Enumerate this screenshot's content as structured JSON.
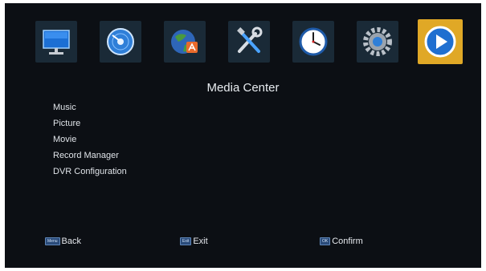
{
  "title": "Media Center",
  "top_icons": [
    {
      "name": "tv-icon",
      "active": false
    },
    {
      "name": "disc-icon",
      "active": false
    },
    {
      "name": "globe-icon",
      "active": false
    },
    {
      "name": "tools-icon",
      "active": false
    },
    {
      "name": "clock-icon",
      "active": false
    },
    {
      "name": "gear-icon",
      "active": false
    },
    {
      "name": "play-icon",
      "active": true
    }
  ],
  "menu": {
    "items": [
      "Music",
      "Picture",
      "Movie",
      "Record Manager",
      "DVR Configuration"
    ]
  },
  "footer": {
    "back": {
      "key": "Menu",
      "label": "Back"
    },
    "exit": {
      "key": "Exit",
      "label": "Exit"
    },
    "confirm": {
      "key": "OK",
      "label": "Confirm"
    }
  },
  "colors": {
    "background": "#0c0f14",
    "tile": "#1a2a37",
    "active_tile": "#e0a826"
  }
}
